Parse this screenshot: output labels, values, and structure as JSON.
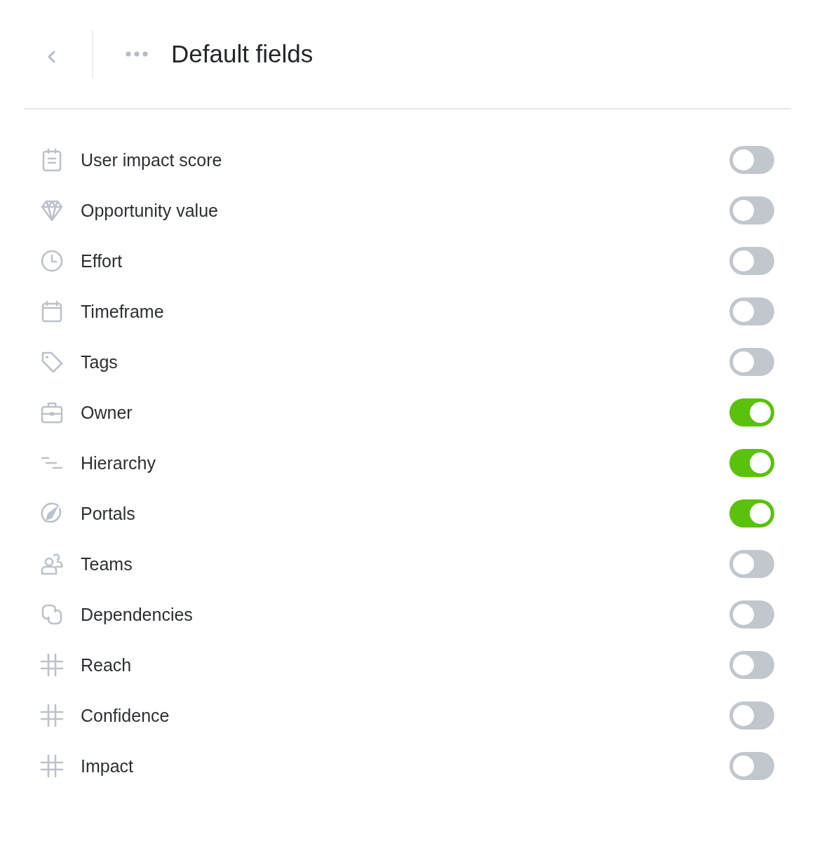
{
  "header": {
    "title": "Default fields"
  },
  "fields": [
    {
      "kind": "clipboard",
      "label": "User impact score",
      "on": false
    },
    {
      "kind": "diamond",
      "label": "Opportunity value",
      "on": false
    },
    {
      "kind": "clock",
      "label": "Effort",
      "on": false
    },
    {
      "kind": "calendar",
      "label": "Timeframe",
      "on": false
    },
    {
      "kind": "tag",
      "label": "Tags",
      "on": false
    },
    {
      "kind": "briefcase",
      "label": "Owner",
      "on": true
    },
    {
      "kind": "hierarchy",
      "label": "Hierarchy",
      "on": true
    },
    {
      "kind": "compass",
      "label": "Portals",
      "on": true
    },
    {
      "kind": "people",
      "label": "Teams",
      "on": false
    },
    {
      "kind": "link",
      "label": "Dependencies",
      "on": false
    },
    {
      "kind": "hash",
      "label": "Reach",
      "on": false
    },
    {
      "kind": "hash",
      "label": "Confidence",
      "on": false
    },
    {
      "kind": "hash",
      "label": "Impact",
      "on": false
    }
  ]
}
